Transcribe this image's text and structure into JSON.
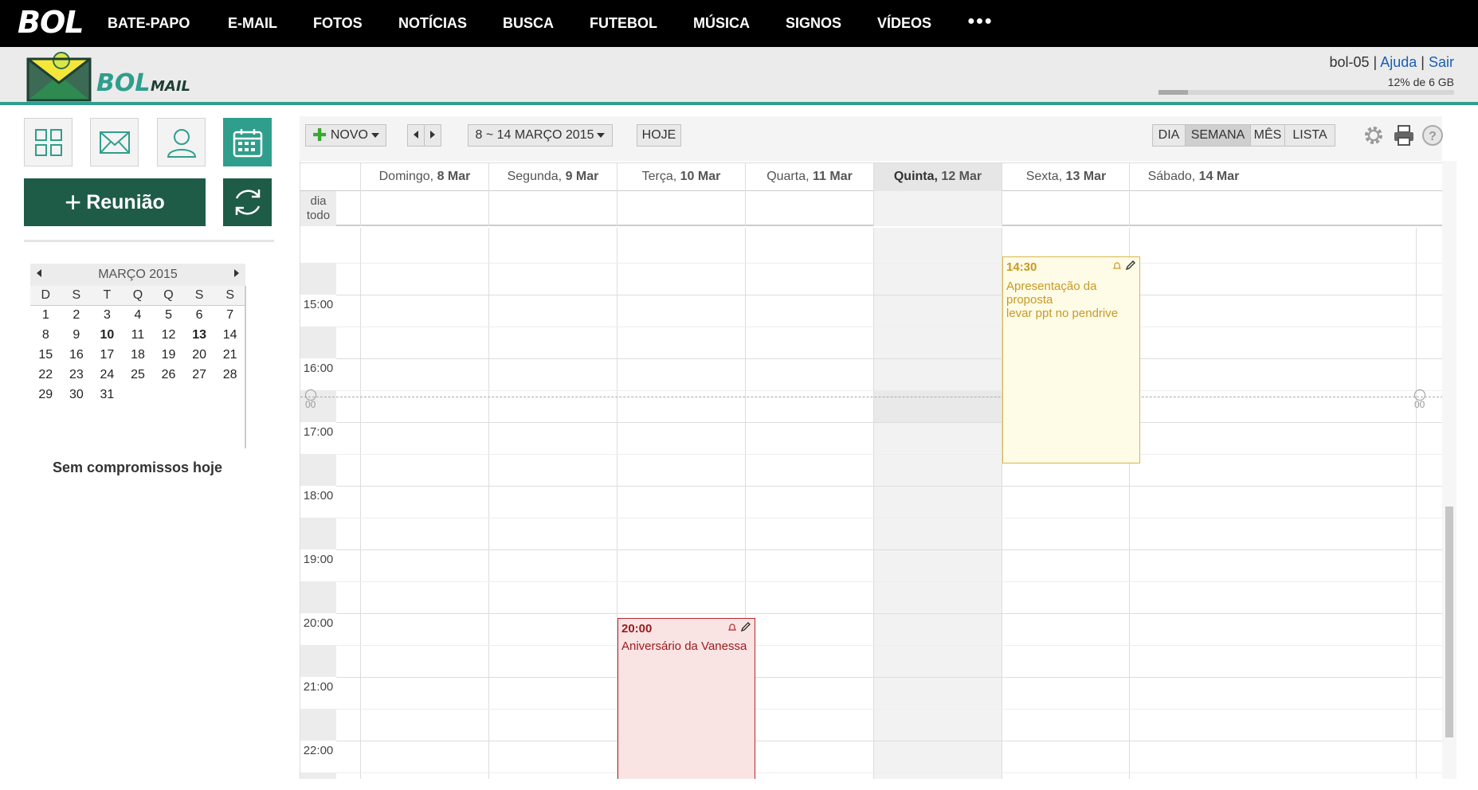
{
  "topnav": {
    "brand": "BOL",
    "items": [
      "BATE-PAPO",
      "E-MAIL",
      "FOTOS",
      "NOTÍCIAS",
      "BUSCA",
      "FUTEBOL",
      "MÚSICA",
      "SIGNOS",
      "VÍDEOS"
    ],
    "more": "●●●"
  },
  "header": {
    "logo_text": "BOL",
    "logo_sub": "MAIL",
    "user": "bol-05",
    "sep": "|",
    "help": "Ajuda",
    "logout": "Sair",
    "quota_text": "12% de 6 GB",
    "quota_fraction": 0.1
  },
  "sidebar": {
    "apps": [
      "apps-icon",
      "mail-icon",
      "contacts-icon",
      "calendar-icon"
    ],
    "new_meeting_plus": "+",
    "new_meeting": "Reunião",
    "mini_calendar": {
      "month": "MARÇO 2015",
      "weekdays": [
        "D",
        "S",
        "T",
        "Q",
        "Q",
        "S",
        "S"
      ],
      "weeks": [
        [
          "1",
          "2",
          "3",
          "4",
          "5",
          "6",
          "7"
        ],
        [
          "8",
          "9",
          "10",
          "11",
          "12",
          "13",
          "14"
        ],
        [
          "15",
          "16",
          "17",
          "18",
          "19",
          "20",
          "21"
        ],
        [
          "22",
          "23",
          "24",
          "25",
          "26",
          "27",
          "28"
        ],
        [
          "29",
          "30",
          "31",
          "",
          "",
          "",
          ""
        ]
      ],
      "bold_days": [
        "10",
        "13"
      ]
    },
    "no_events": "Sem compromissos hoje"
  },
  "toolbar": {
    "new_label": "NOVO",
    "date_range": "8 ~ 14 MARÇO 2015",
    "today": "HOJE",
    "views": [
      "DIA",
      "SEMANA",
      "MÊS",
      "LISTA"
    ],
    "active_view": "SEMANA"
  },
  "calendar": {
    "allday_label_1": "dia",
    "allday_label_2": "todo",
    "days": [
      {
        "name": "Domingo,",
        "date": "8 Mar"
      },
      {
        "name": "Segunda,",
        "date": "9 Mar"
      },
      {
        "name": "Terça,",
        "date": "10 Mar"
      },
      {
        "name": "Quarta,",
        "date": "11 Mar"
      },
      {
        "name": "Quinta,",
        "date": "12 Mar"
      },
      {
        "name": "Sexta,",
        "date": "13 Mar"
      },
      {
        "name": "Sábado,",
        "date": "14 Mar"
      }
    ],
    "today_index": 4,
    "hours": [
      "15:00",
      "16:00",
      "17:00",
      "18:00",
      "19:00",
      "20:00",
      "21:00",
      "22:00"
    ],
    "now_mark": "00",
    "events": [
      {
        "time": "14:30",
        "title_1": "Apresentação da",
        "title_2": "proposta",
        "title_3": "levar ppt no pendrive",
        "color": "#d9b648"
      },
      {
        "time": "20:00",
        "title_1": "Aniversário da Vanessa",
        "color": "#b8262a"
      }
    ]
  },
  "colors": {
    "accent": "#2f9e8c",
    "dark_green": "#1e5c48",
    "link": "#1a5fb4"
  }
}
